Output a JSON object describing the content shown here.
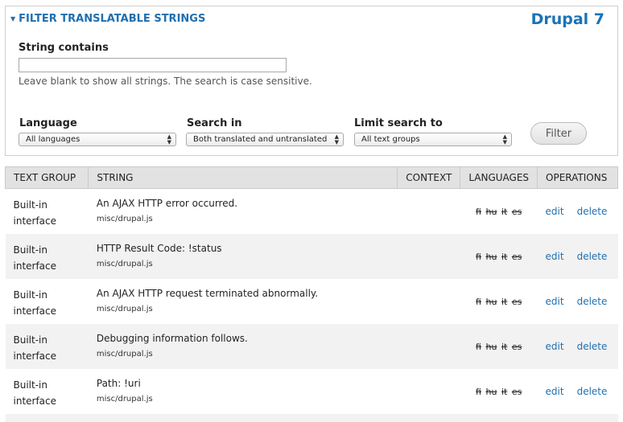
{
  "filter": {
    "legend": "FILTER TRANSLATABLE STRINGS",
    "brand": "Drupal 7",
    "string_contains_label": "String contains",
    "string_contains_value": "",
    "description": "Leave blank to show all strings. The search is case sensitive.",
    "language_label": "Language",
    "language_value": "All languages",
    "search_in_label": "Search in",
    "search_in_value": "Both translated and untranslated",
    "limit_label": "Limit search to",
    "limit_value": "All text groups",
    "button_label": "Filter"
  },
  "table": {
    "headers": [
      "TEXT GROUP",
      "STRING",
      "CONTEXT",
      "LANGUAGES",
      "OPERATIONS"
    ],
    "rows": [
      {
        "group_line1": "Built-in",
        "group_line2": "interface",
        "string": "An AJAX HTTP error occurred.",
        "source": "misc/drupal.js",
        "context": "",
        "langs": [
          "fi",
          "hu",
          "it",
          "es"
        ],
        "edit": "edit",
        "delete": "delete"
      },
      {
        "group_line1": "Built-in",
        "group_line2": "interface",
        "string": "HTTP Result Code: !status",
        "source": "misc/drupal.js",
        "context": "",
        "langs": [
          "fi",
          "hu",
          "it",
          "es"
        ],
        "edit": "edit",
        "delete": "delete"
      },
      {
        "group_line1": "Built-in",
        "group_line2": "interface",
        "string": "An AJAX HTTP request terminated abnormally.",
        "source": "misc/drupal.js",
        "context": "",
        "langs": [
          "fi",
          "hu",
          "it",
          "es"
        ],
        "edit": "edit",
        "delete": "delete"
      },
      {
        "group_line1": "Built-in",
        "group_line2": "interface",
        "string": "Debugging information follows.",
        "source": "misc/drupal.js",
        "context": "",
        "langs": [
          "fi",
          "hu",
          "it",
          "es"
        ],
        "edit": "edit",
        "delete": "delete"
      },
      {
        "group_line1": "Built-in",
        "group_line2": "interface",
        "string": "Path: !uri",
        "source": "misc/drupal.js",
        "context": "",
        "langs": [
          "fi",
          "hu",
          "it",
          "es"
        ],
        "edit": "edit",
        "delete": "delete"
      }
    ]
  },
  "colors": {
    "link": "#1f6fb0",
    "brand": "#1a73b8",
    "header_bg": "#e2e2e2",
    "stripe": "#f2f2f2"
  },
  "icons": {
    "collapse": "triangle-down-icon",
    "select_arrows": "updown-arrows-icon"
  }
}
